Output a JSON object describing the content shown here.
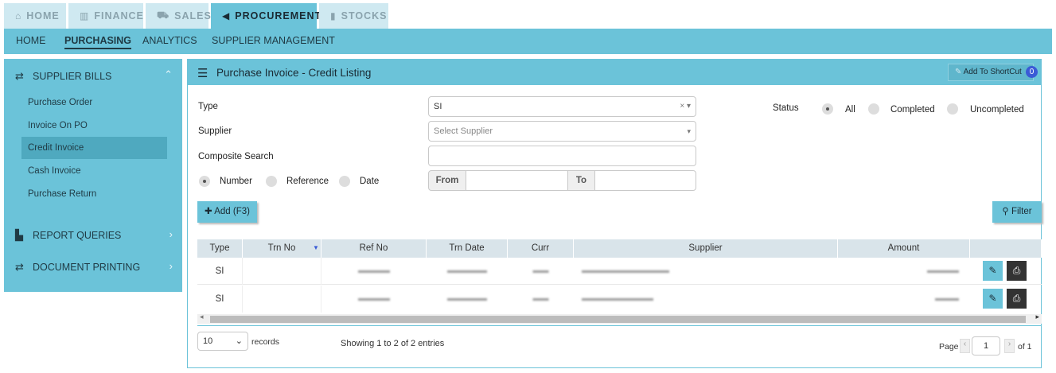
{
  "top_tabs": [
    {
      "label": "HOME",
      "icon": "home-icon"
    },
    {
      "label": "FINANCE",
      "icon": "bank-icon"
    },
    {
      "label": "SALES",
      "icon": "cart-icon"
    },
    {
      "label": "PROCUREMENT",
      "icon": "megaphone-icon",
      "active": true
    },
    {
      "label": "STOCKS",
      "icon": "bar-chart-icon"
    }
  ],
  "sub_nav": [
    "HOME",
    "PURCHASING",
    "ANALYTICS",
    "SUPPLIER MANAGEMENT"
  ],
  "sidebar": {
    "groups": [
      {
        "label": "SUPPLIER BILLS",
        "icon": "swap-icon",
        "expanded": true
      },
      {
        "label": "REPORT QUERIES",
        "icon": "chart-icon"
      },
      {
        "label": "DOCUMENT PRINTING",
        "icon": "swap-icon"
      }
    ],
    "items": [
      "Purchase Order",
      "Invoice On PO",
      "Credit Invoice",
      "Cash Invoice",
      "Purchase Return"
    ]
  },
  "main": {
    "title": "Purchase Invoice - Credit Listing",
    "shortcut_label": "Add To ShortCut",
    "shortcut_count": "0",
    "type_label": "Type",
    "type_value": "SI",
    "supplier_label": "Supplier",
    "supplier_placeholder": "Select Supplier",
    "composite_label": "Composite Search",
    "search_by": [
      "Number",
      "Reference",
      "Date"
    ],
    "from_label": "From",
    "to_label": "To",
    "status_label": "Status",
    "status_options": [
      "All",
      "Completed",
      "Uncompleted"
    ],
    "add_label": "Add (F3)",
    "filter_label": "Filter"
  },
  "table": {
    "columns": [
      "Type",
      "Trn No",
      "Ref No",
      "Trn Date",
      "Curr",
      "Supplier",
      "Amount"
    ],
    "rows": [
      {
        "type": "SI"
      },
      {
        "type": "SI"
      }
    ]
  },
  "footer": {
    "page_size": "10",
    "records_label": "records",
    "showing": "Showing 1 to 2 of 2 entries",
    "page_label": "Page",
    "page_value": "1",
    "of_label": "of 1"
  },
  "colors": {
    "accent": "#6bc3d9",
    "accent_light": "#cfe9f1",
    "header_row": "#d9e4ea"
  }
}
